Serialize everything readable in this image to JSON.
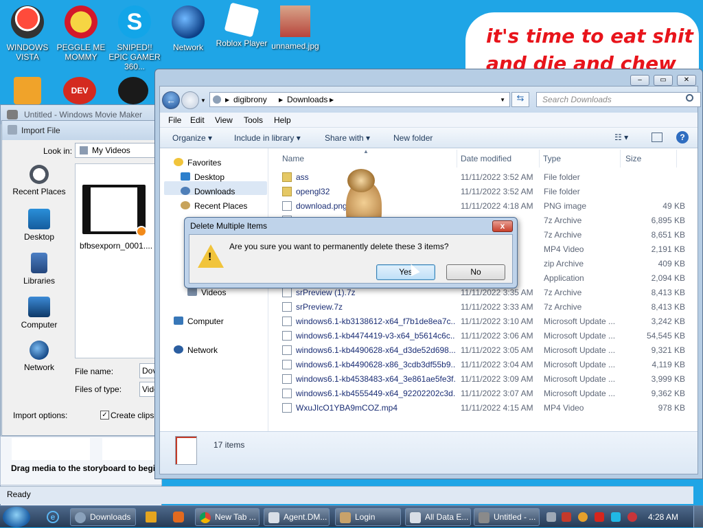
{
  "desktop": {
    "icons": [
      {
        "label": "WINDOWS VISTA"
      },
      {
        "label": "PEGGLE ME MOMMY"
      },
      {
        "label": "SNIPED!! EPIC GAMER 360..."
      },
      {
        "label": "Network"
      },
      {
        "label": "Roblox Player"
      },
      {
        "label": "unnamed.jpg"
      }
    ],
    "meme_line1": "it's time to eat shit",
    "meme_line2": "and die and chew",
    "dev_icon_text": "DEV C++"
  },
  "movie_maker": {
    "title": "Untitled - Windows Movie Maker",
    "drag_text": "Drag media to the storyboard to begi",
    "status": "Ready"
  },
  "import_dialog": {
    "title": "Import File",
    "look_in_label": "Look in:",
    "look_in_value": "My Videos",
    "places": [
      "Recent Places",
      "Desktop",
      "Libraries",
      "Computer",
      "Network"
    ],
    "thumb_label": "bfbsexporn_0001....",
    "file_name_label": "File name:",
    "file_name_value": "Dov",
    "files_of_type_label": "Files of type:",
    "files_of_type_value": "Vide",
    "import_options_label": "Import options:",
    "create_clips_label": "Create clips f"
  },
  "explorer": {
    "breadcrumb": [
      "digibrony",
      "Downloads"
    ],
    "search_placeholder": "Search Downloads",
    "menu": [
      "File",
      "Edit",
      "View",
      "Tools",
      "Help"
    ],
    "toolbar": {
      "organize": "Organize",
      "include": "Include in library",
      "share": "Share with",
      "new_folder": "New folder"
    },
    "nav": {
      "favorites": "Favorites",
      "desktop": "Desktop",
      "downloads": "Downloads",
      "recent": "Recent Places",
      "videos": "Videos",
      "computer": "Computer",
      "network": "Network"
    },
    "columns": {
      "name": "Name",
      "date": "Date modified",
      "type": "Type",
      "size": "Size"
    },
    "files": [
      {
        "name": "ass",
        "date": "11/11/2022 3:52 AM",
        "type": "File folder",
        "size": ""
      },
      {
        "name": "opengl32",
        "date": "11/11/2022 3:52 AM",
        "type": "File folder",
        "size": ""
      },
      {
        "name": "download.png",
        "date": "11/11/2022 4:18 AM",
        "type": "PNG image",
        "size": "49 KB"
      },
      {
        "name": "",
        "date": "",
        "type": "7z Archive",
        "size": "6,895 KB"
      },
      {
        "name": "",
        "date": "",
        "type": "7z Archive",
        "size": "8,651 KB"
      },
      {
        "name": "",
        "date": "",
        "type": "MP4 Video",
        "size": "2,191 KB"
      },
      {
        "name": "",
        "date": "",
        "type": "zip Archive",
        "size": "409 KB"
      },
      {
        "name": "",
        "date": "",
        "type": "Application",
        "size": "2,094 KB"
      },
      {
        "name": "srPreview (1).7z",
        "date": "11/11/2022 3:35 AM",
        "type": "7z Archive",
        "size": "8,413 KB"
      },
      {
        "name": "srPreview.7z",
        "date": "11/11/2022 3:33 AM",
        "type": "7z Archive",
        "size": "8,413 KB"
      },
      {
        "name": "windows6.1-kb3138612-x64_f7b1de8ea7c...",
        "date": "11/11/2022 3:10 AM",
        "type": "Microsoft Update ...",
        "size": "3,242 KB"
      },
      {
        "name": "windows6.1-kb4474419-v3-x64_b5614c6c...",
        "date": "11/11/2022 3:06 AM",
        "type": "Microsoft Update ...",
        "size": "54,545 KB"
      },
      {
        "name": "windows6.1-kb4490628-x64_d3de52d698...",
        "date": "11/11/2022 3:05 AM",
        "type": "Microsoft Update ...",
        "size": "9,321 KB"
      },
      {
        "name": "windows6.1-kb4490628-x86_3cdb3df55b9...",
        "date": "11/11/2022 3:04 AM",
        "type": "Microsoft Update ...",
        "size": "4,119 KB"
      },
      {
        "name": "windows6.1-kb4538483-x64_3e861ae5fe3f...",
        "date": "11/11/2022 3:09 AM",
        "type": "Microsoft Update ...",
        "size": "3,999 KB"
      },
      {
        "name": "windows6.1-kb4555449-x64_92202202c3d...",
        "date": "11/11/2022 3:07 AM",
        "type": "Microsoft Update ...",
        "size": "9,362 KB"
      },
      {
        "name": "WxuJIcO1YBA9mCOZ.mp4",
        "date": "11/11/2022 4:15 AM",
        "type": "MP4 Video",
        "size": "978 KB"
      }
    ],
    "item_count": "17 items"
  },
  "delete_dialog": {
    "title": "Delete Multiple Items",
    "message": "Are you sure you want to permanently delete these 3 items?",
    "yes": "Yes",
    "no": "No",
    "close": "x"
  },
  "taskbar": {
    "items": [
      "Downloads",
      "New Tab ...",
      "Agent.DM...",
      "Login",
      "All Data E...",
      "Untitled - ..."
    ],
    "clock": "4:28 AM"
  }
}
